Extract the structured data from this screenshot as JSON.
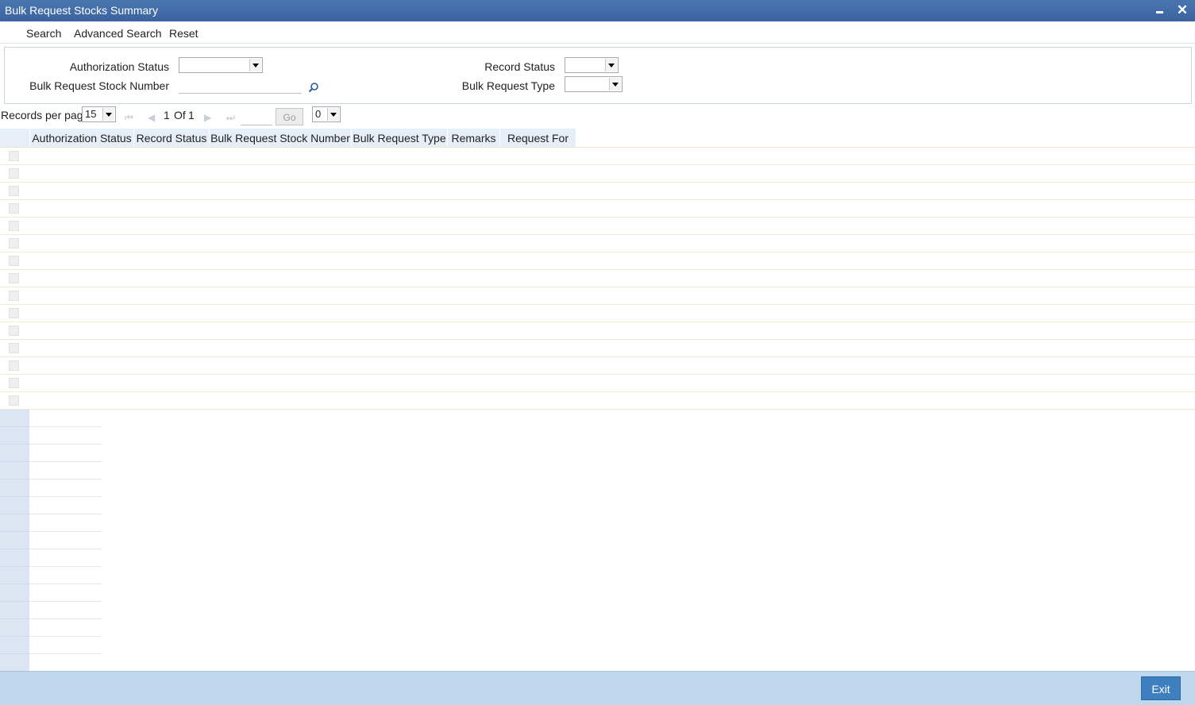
{
  "window": {
    "title": "Bulk Request Stocks Summary"
  },
  "menu": {
    "search": "Search",
    "advanced_search": "Advanced Search",
    "reset": "Reset"
  },
  "criteria": {
    "authorization_status_label": "Authorization Status",
    "authorization_status_value": "",
    "bulk_request_stock_number_label": "Bulk Request Stock Number",
    "bulk_request_stock_number_value": "",
    "record_status_label": "Record Status",
    "record_status_value": "",
    "bulk_request_type_label": "Bulk Request Type",
    "bulk_request_type_value": ""
  },
  "pager": {
    "records_per_page_label": "Records per page",
    "records_per_page_value": "15",
    "current_page": "1",
    "of_label": "Of",
    "total_pages": "1",
    "go_label": "Go",
    "extra_select_value": "0"
  },
  "grid": {
    "columns": [
      "Authorization Status",
      "Record Status",
      "Bulk Request Stock Number",
      "Bulk Request Type",
      "Remarks",
      "Request For"
    ]
  },
  "footer": {
    "exit_label": "Exit"
  },
  "colors": {
    "title_bar": "#3a63a0",
    "footer": "#bfd7ed",
    "exit_button": "#3d7fbf",
    "header_cell": "#e6eef8"
  }
}
